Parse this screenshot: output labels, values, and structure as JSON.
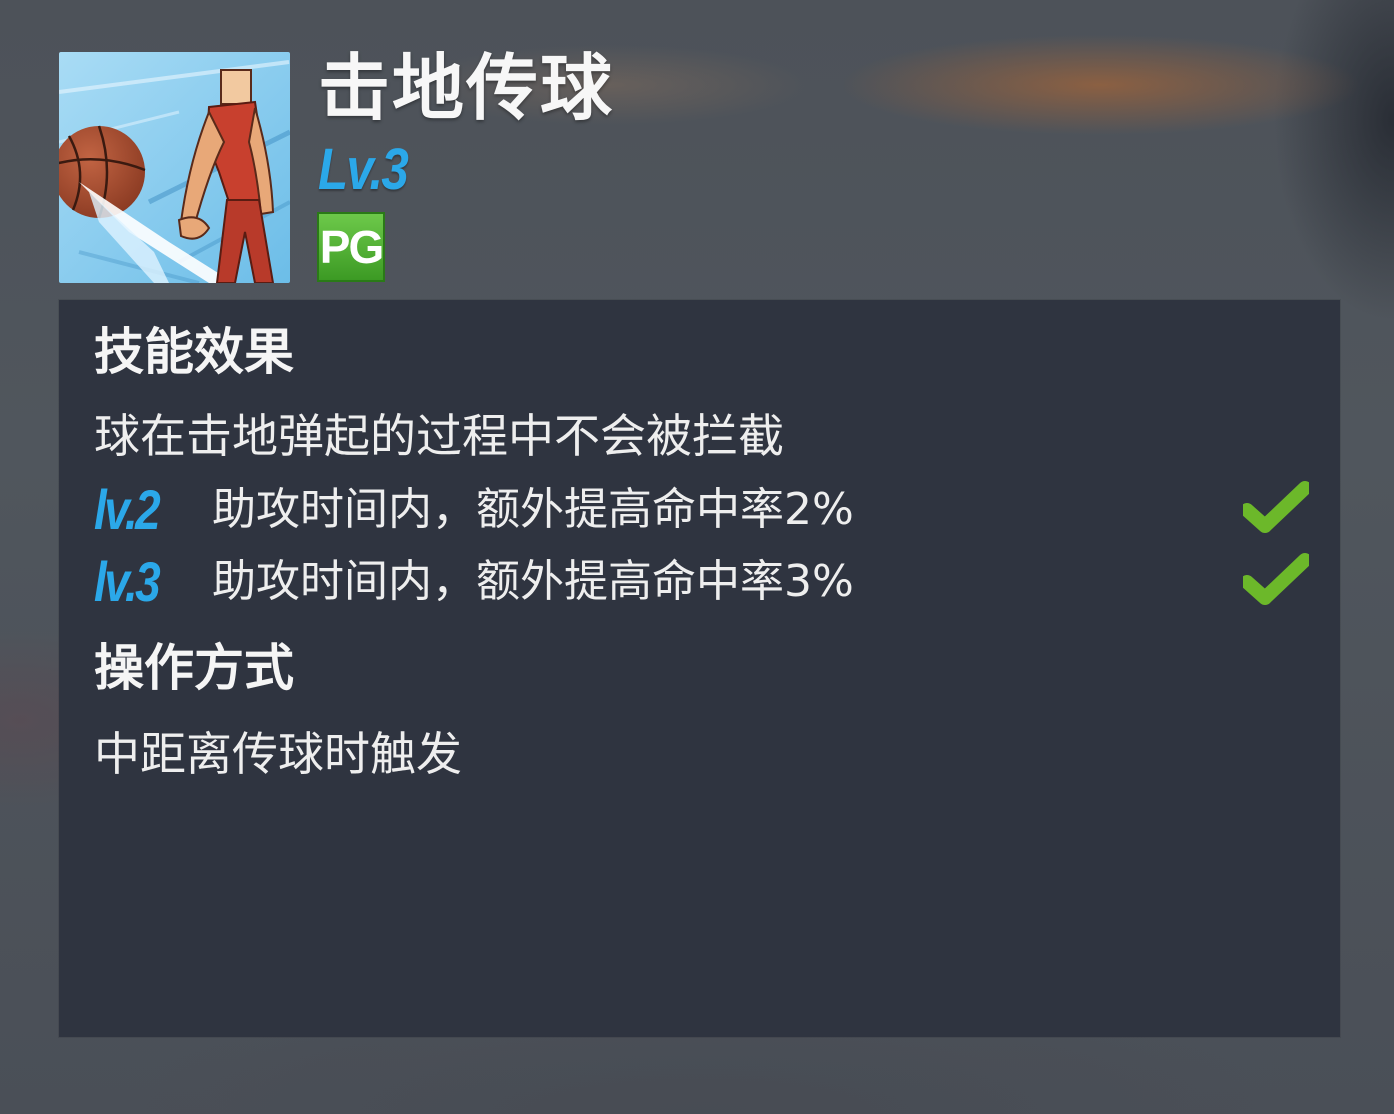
{
  "skill": {
    "title": "击地传球",
    "level": "Lv.3",
    "position_badge": "PG",
    "icon": "basketball-player-bounce-pass-icon"
  },
  "panel": {
    "effect_heading": "技能效果",
    "effect_text": "球在击地弹起的过程中不会被拦截",
    "upgrades": [
      {
        "level": "lv.2",
        "text": "助攻时间内，额外提高命中率2%",
        "unlocked": true
      },
      {
        "level": "lv.3",
        "text": "助攻时间内，额外提高命中率3%",
        "unlocked": true
      }
    ],
    "operation_heading": "操作方式",
    "operation_text": "中距离传球时触发"
  },
  "colors": {
    "level_blue": "#2ba8e9",
    "badge_green": "#4caf2f",
    "check_green": "#6cb82a",
    "panel_bg": "#2f3440"
  }
}
